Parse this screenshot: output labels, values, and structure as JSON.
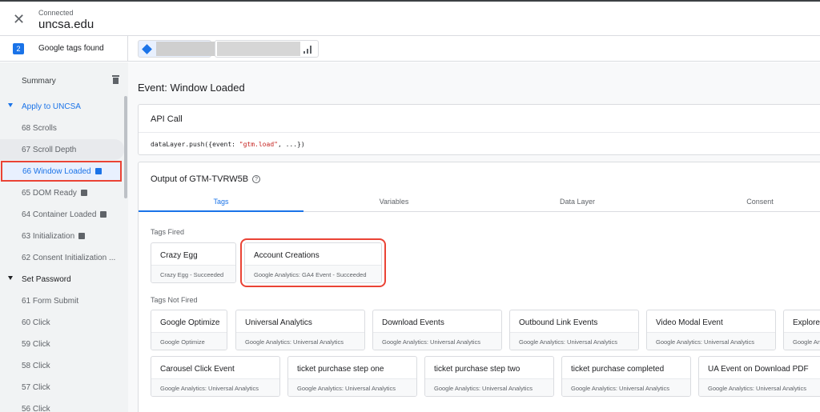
{
  "header": {
    "close_icon": "close-icon",
    "connection_label": "Connected",
    "domain": "uncsa.edu"
  },
  "tagsbar": {
    "count": "2",
    "found_label": "Google tags found",
    "signal_icon": "signal-bars-icon"
  },
  "sidebar": {
    "summary_label": "Summary",
    "items": [
      {
        "label": "Apply to UNCSA"
      },
      {
        "label": "68 Scrolls"
      },
      {
        "label": "67 Scroll Depth"
      },
      {
        "label": "66 Window Loaded"
      },
      {
        "label": "65 DOM Ready"
      },
      {
        "label": "64 Container Loaded"
      },
      {
        "label": "63 Initialization"
      },
      {
        "label": "62 Consent Initialization ..."
      },
      {
        "label": "Set Password"
      },
      {
        "label": "61 Form Submit"
      },
      {
        "label": "60 Click"
      },
      {
        "label": "59 Click"
      },
      {
        "label": "58 Click"
      },
      {
        "label": "57 Click"
      },
      {
        "label": "56 Click"
      }
    ]
  },
  "main": {
    "event_title": "Event: Window Loaded",
    "api": {
      "title": "API Call",
      "code_prefix": "dataLayer.push({event: ",
      "code_string": "\"gtm.load\"",
      "code_suffix": ", ...})"
    },
    "output": {
      "title": "Output of GTM-TVRW5B",
      "tabs": [
        "Tags",
        "Variables",
        "Data Layer",
        "Consent"
      ],
      "fired_label": "Tags Fired",
      "fired": [
        {
          "name": "Crazy Egg",
          "status": "Crazy Egg - Succeeded"
        },
        {
          "name": "Account Creations",
          "status": "Google Analytics: GA4 Event - Succeeded"
        }
      ],
      "not_fired_label": "Tags Not Fired",
      "not_fired_row1": [
        {
          "name": "Google Optimize",
          "status": "Google Optimize"
        },
        {
          "name": "Universal Analytics",
          "status": "Google Analytics: Universal Analytics"
        },
        {
          "name": "Download Events",
          "status": "Google Analytics: Universal Analytics"
        },
        {
          "name": "Outbound Link Events",
          "status": "Google Analytics: Universal Analytics"
        },
        {
          "name": "Video Modal Event",
          "status": "Google Analytics: Universal Analytics"
        },
        {
          "name": "Explore",
          "status": "Google Analytics: Universal Analytics"
        }
      ],
      "not_fired_row2": [
        {
          "name": "Carousel Click Event",
          "status": "Google Analytics: Universal Analytics"
        },
        {
          "name": "ticket purchase step one",
          "status": "Google Analytics: Universal Analytics"
        },
        {
          "name": "ticket purchase step two",
          "status": "Google Analytics: Universal Analytics"
        },
        {
          "name": "ticket purchase completed",
          "status": "Google Analytics: Universal Analytics"
        },
        {
          "name": "UA Event on Download PDF",
          "status": "Google Analytics: Universal Analytics"
        }
      ]
    }
  },
  "colors": {
    "accent": "#1a73e8",
    "highlight": "#ea4335"
  }
}
